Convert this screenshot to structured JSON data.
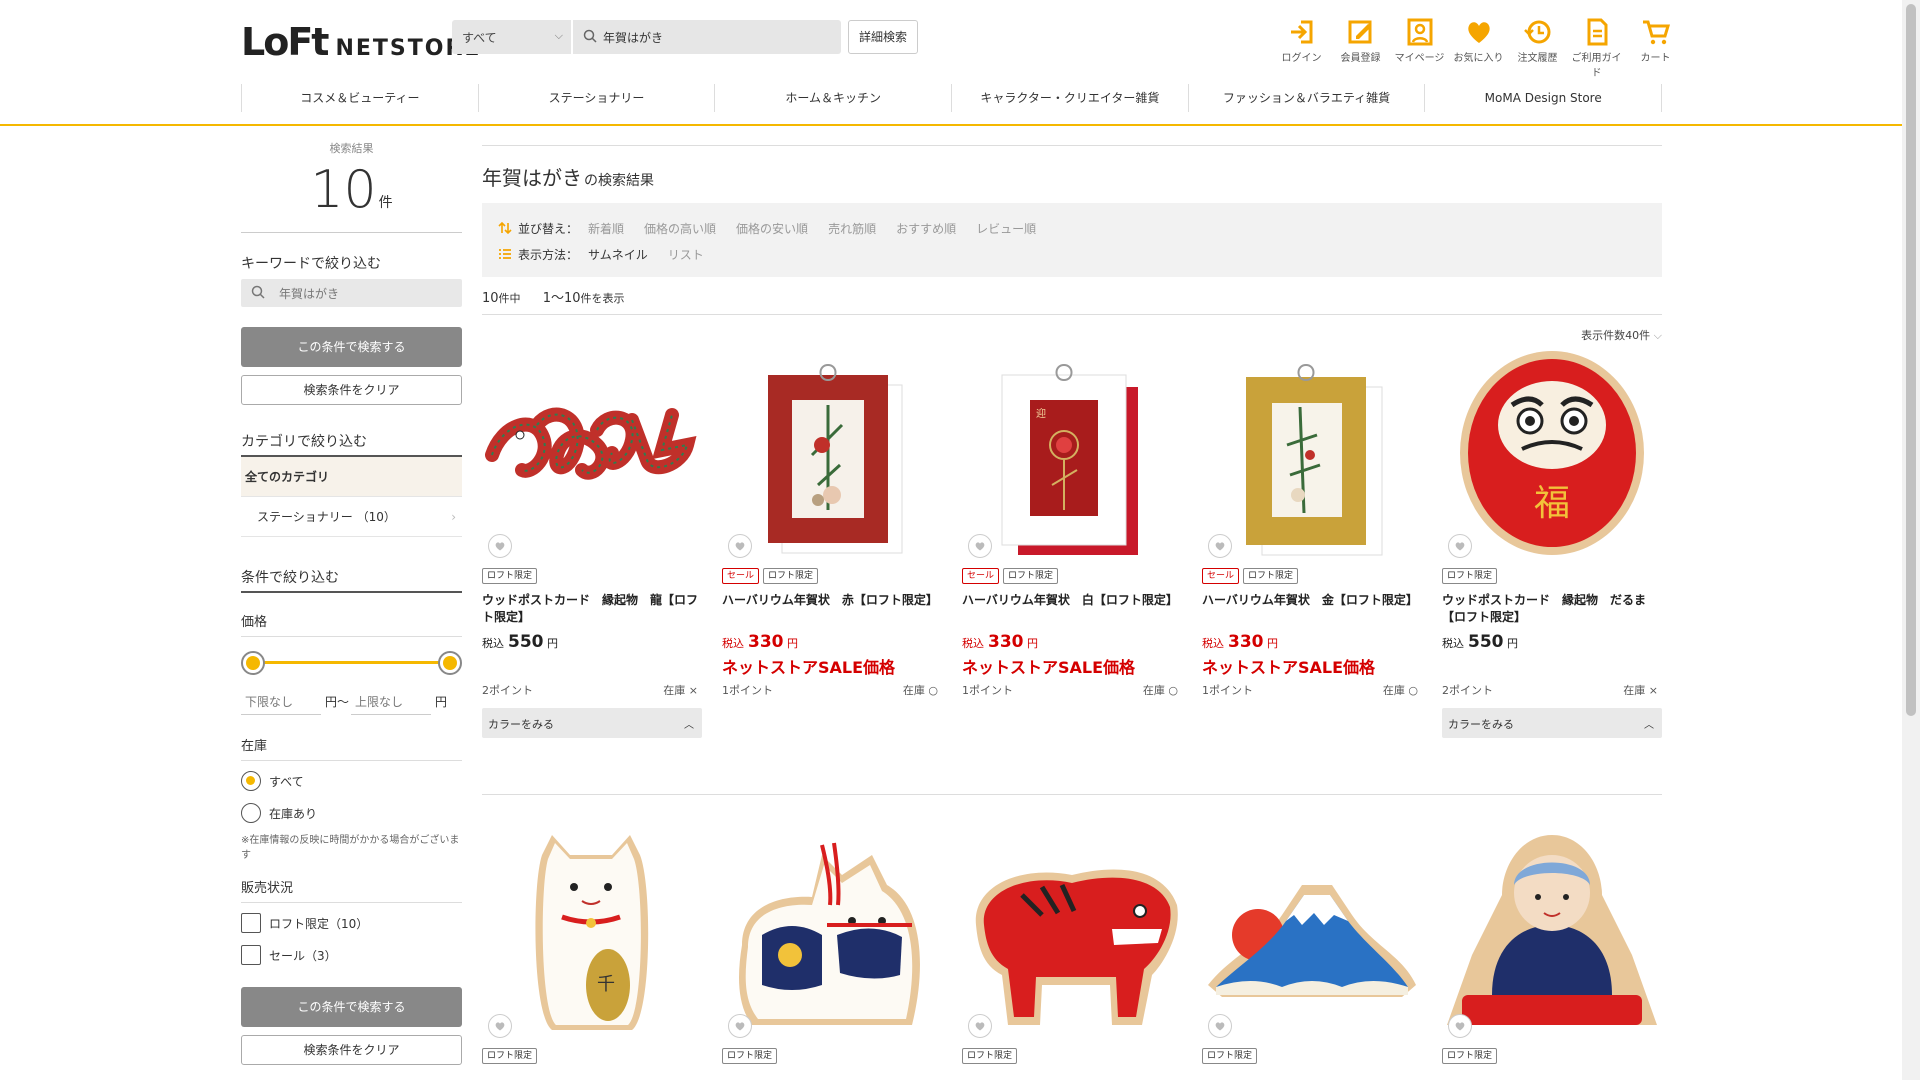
{
  "header": {
    "logo_mark": "LoFt",
    "logo_text": "NETSTORE",
    "category_select": "すべて",
    "search_value": "年賀はがき",
    "advanced_search": "詳細検索",
    "icons": [
      {
        "name": "login-icon",
        "label": "ログイン"
      },
      {
        "name": "register-icon",
        "label": "会員登録"
      },
      {
        "name": "mypage-icon",
        "label": "マイページ"
      },
      {
        "name": "favorite-icon",
        "label": "お気に入り"
      },
      {
        "name": "history-icon",
        "label": "注文履歴"
      },
      {
        "name": "guide-icon",
        "label": "ご利用ガイド"
      },
      {
        "name": "cart-icon",
        "label": "カート"
      }
    ],
    "nav": [
      "コスメ＆ビューティー",
      "ステーショナリー",
      "ホーム＆キッチン",
      "キャラクター・クリエイター雑貨",
      "ファッション＆バラエティ雑貨",
      "MoMA Design Store"
    ],
    "accent": "#f5b800"
  },
  "sidebar": {
    "count_label": "検索結果",
    "count": "10",
    "count_unit": "件",
    "keyword_title": "キーワードで絞り込む",
    "keyword_value": "年賀はがき",
    "search_button": "この条件で検索する",
    "clear_button": "検索条件をクリア",
    "category_title": "カテゴリで絞り込む",
    "category_all": "全てのカテゴリ",
    "category_item": "ステーショナリー （10）",
    "conditions_title": "条件で絞り込む",
    "price_label": "価格",
    "price_min_placeholder": "下限なし",
    "price_max_placeholder": "上限なし",
    "yen": "円",
    "yen_tilde": "円～",
    "stock_label": "在庫",
    "stock_all": "すべて",
    "stock_in": "在庫あり",
    "stock_note": "※在庫情報の反映に時間がかかる場合がございます",
    "sales_label": "販売状況",
    "loft_only": "ロフト限定（10）",
    "sale": "セール（3）",
    "search_button2": "この条件で検索する",
    "clear_button2": "検索条件をクリア"
  },
  "main": {
    "keyword": "年賀はがき",
    "title_suffix": "の検索結果",
    "sort_label": "並び替え：",
    "sort_options": [
      "新着順",
      "価格の高い順",
      "価格の安い順",
      "売れ筋順",
      "おすすめ順",
      "レビュー順"
    ],
    "view_label": "表示方法：",
    "view_options": [
      "サムネイル",
      "リスト"
    ],
    "total": "10",
    "total_suffix": "件中",
    "range": "1～10",
    "range_suffix": "件を表示",
    "per_page": "表示件数40件"
  },
  "products": [
    {
      "name": "ウッドポストカード　縁起物　龍【ロフト限定】",
      "tags": [
        "ロフト限定"
      ],
      "tax": "税込",
      "price": "550",
      "yen": "円",
      "sale": false,
      "sale_label": "",
      "points": "2ポイント",
      "stock": "在庫 ×",
      "color_btn": "カラーをみる",
      "img": "dragon"
    },
    {
      "name": "ハーバリウム年賀状　赤【ロフト限定】",
      "tags": [
        "セール",
        "ロフト限定"
      ],
      "tax": "税込",
      "price": "330",
      "yen": "円",
      "sale": true,
      "sale_label": "ネットストアSALE価格",
      "points": "1ポイント",
      "stock": "在庫 ○",
      "color_btn": "",
      "img": "red"
    },
    {
      "name": "ハーバリウム年賀状　白【ロフト限定】",
      "tags": [
        "セール",
        "ロフト限定"
      ],
      "tax": "税込",
      "price": "330",
      "yen": "円",
      "sale": true,
      "sale_label": "ネットストアSALE価格",
      "points": "1ポイント",
      "stock": "在庫 ○",
      "color_btn": "",
      "img": "white"
    },
    {
      "name": "ハーバリウム年賀状　金【ロフト限定】",
      "tags": [
        "セール",
        "ロフト限定"
      ],
      "tax": "税込",
      "price": "330",
      "yen": "円",
      "sale": true,
      "sale_label": "ネットストアSALE価格",
      "points": "1ポイント",
      "stock": "在庫 ○",
      "color_btn": "",
      "img": "gold"
    },
    {
      "name": "ウッドポストカード　縁起物　だるま【ロフト限定】",
      "tags": [
        "ロフト限定"
      ],
      "tax": "税込",
      "price": "550",
      "yen": "円",
      "sale": false,
      "sale_label": "",
      "points": "2ポイント",
      "stock": "在庫 ×",
      "color_btn": "カラーをみる",
      "img": "daruma"
    },
    {
      "name": "",
      "tags": [
        "ロフト限定"
      ],
      "img": "cat"
    },
    {
      "name": "",
      "tags": [
        "ロフト限定"
      ],
      "img": "dog"
    },
    {
      "name": "",
      "tags": [
        "ロフト限定"
      ],
      "img": "akabeko"
    },
    {
      "name": "",
      "tags": [
        "ロフト限定"
      ],
      "img": "fuji"
    },
    {
      "name": "",
      "tags": [
        "ロフト限定"
      ],
      "img": "fukusuke"
    }
  ]
}
